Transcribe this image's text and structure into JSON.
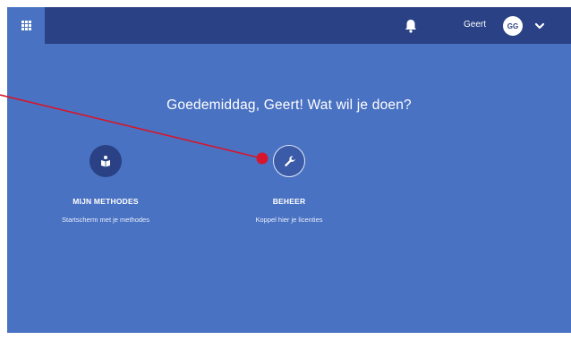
{
  "header": {
    "user_name": "Geert",
    "avatar_initials": "GG",
    "icons": [
      "apps-grid-icon",
      "bell-icon",
      "chevron-down-icon"
    ]
  },
  "main": {
    "greeting": "Goedemiddag, Geert! Wat wil je doen?",
    "tiles": [
      {
        "title": "MIJN METHODES",
        "subtitle": "Startscherm met je methodes",
        "icon": "book-icon"
      },
      {
        "title": "BEHEER",
        "subtitle": "Koppel hier je licenties",
        "icon": "wrench-icon"
      }
    ]
  },
  "colors": {
    "background": "#4a72c2",
    "topbar": "#2a4185",
    "annotation": "#d6162b"
  }
}
